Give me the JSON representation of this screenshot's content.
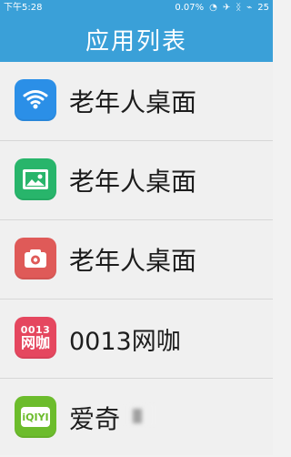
{
  "status_bar": {
    "time": "下午5:28",
    "battery_percent": "0.07%",
    "battery": "25"
  },
  "header": {
    "title": "应用列表"
  },
  "apps": [
    {
      "name": "老年人桌面",
      "icon": "wifi-icon",
      "color": "#2b8fe7"
    },
    {
      "name": "老年人桌面",
      "icon": "gallery-icon",
      "color": "#28b56b"
    },
    {
      "name": "老年人桌面",
      "icon": "camera-icon",
      "color": "#df5a58"
    },
    {
      "name": "0013网咖",
      "icon": "0013-logo-icon",
      "color": "#e5475f"
    },
    {
      "name": "爱奇",
      "icon": "iqiyi-icon",
      "color": "#6cbc2c"
    }
  ]
}
